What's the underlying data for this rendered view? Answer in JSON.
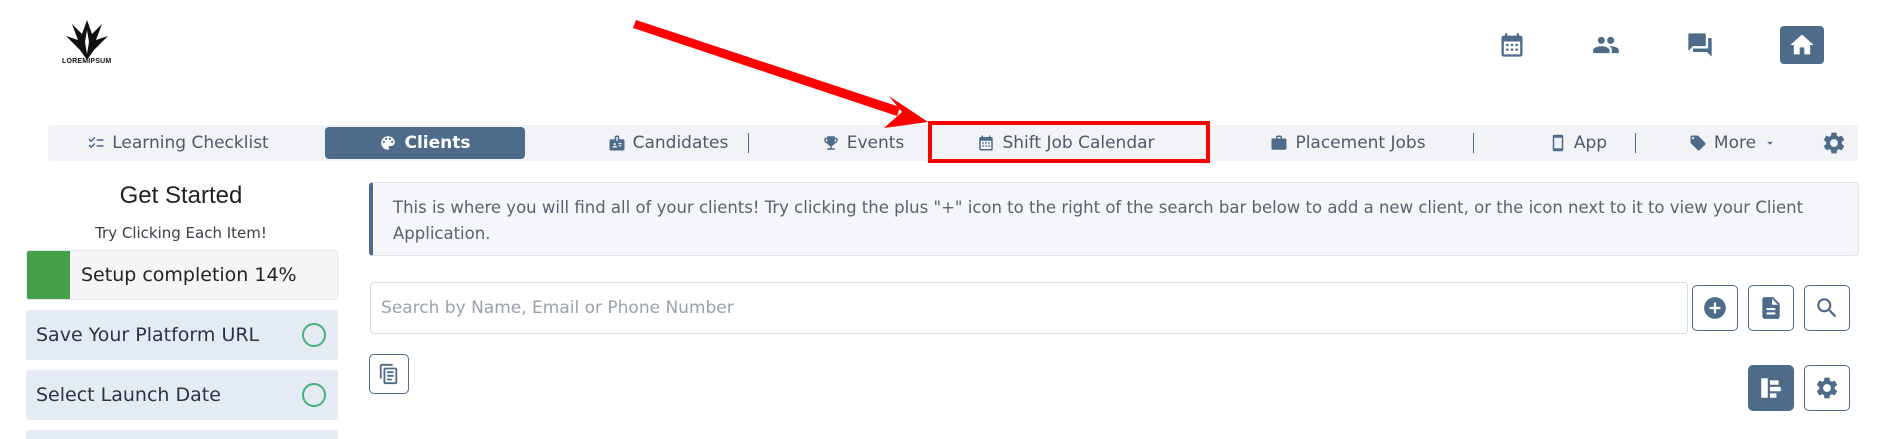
{
  "brand": {
    "logo_text": "LOREMIPSUM"
  },
  "top_nav": {
    "icons": [
      "calendar-icon",
      "people-icon",
      "chat-icon",
      "home-icon"
    ]
  },
  "tabs": [
    {
      "label": "Learning Checklist",
      "icon": "checklist-icon"
    },
    {
      "label": "Clients",
      "icon": "palette-icon",
      "active": true
    },
    {
      "label": "Candidates",
      "icon": "id-badge-icon"
    },
    {
      "label": "Events",
      "icon": "trophy-icon"
    },
    {
      "label": "Shift Job Calendar",
      "icon": "calendar-grid-icon",
      "highlighted": true
    },
    {
      "label": "Placement Jobs",
      "icon": "briefcase-icon"
    },
    {
      "label": "App",
      "icon": "mobile-icon"
    },
    {
      "label": "More",
      "icon": "tag-icon"
    }
  ],
  "sidebar": {
    "title": "Get Started",
    "subtitle": "Try Clicking Each Item!",
    "progress": {
      "label": "Setup completion 14%",
      "value": 0.14
    },
    "steps": [
      {
        "label": "Save Your Platform URL"
      },
      {
        "label": "Select Launch Date"
      }
    ]
  },
  "main": {
    "info_text": "This is where you will find all of your clients! Try clicking the plus \"+\" icon to the right of the search bar below to add a new client, or the icon next to it to view your Client Application.",
    "search": {
      "placeholder": "Search by Name, Email or Phone Number",
      "value": ""
    }
  },
  "colors": {
    "accent": "#4f6b8a",
    "highlight_border": "#ff0000",
    "progress_fill": "#46a049",
    "step_circle": "#44b07a"
  }
}
